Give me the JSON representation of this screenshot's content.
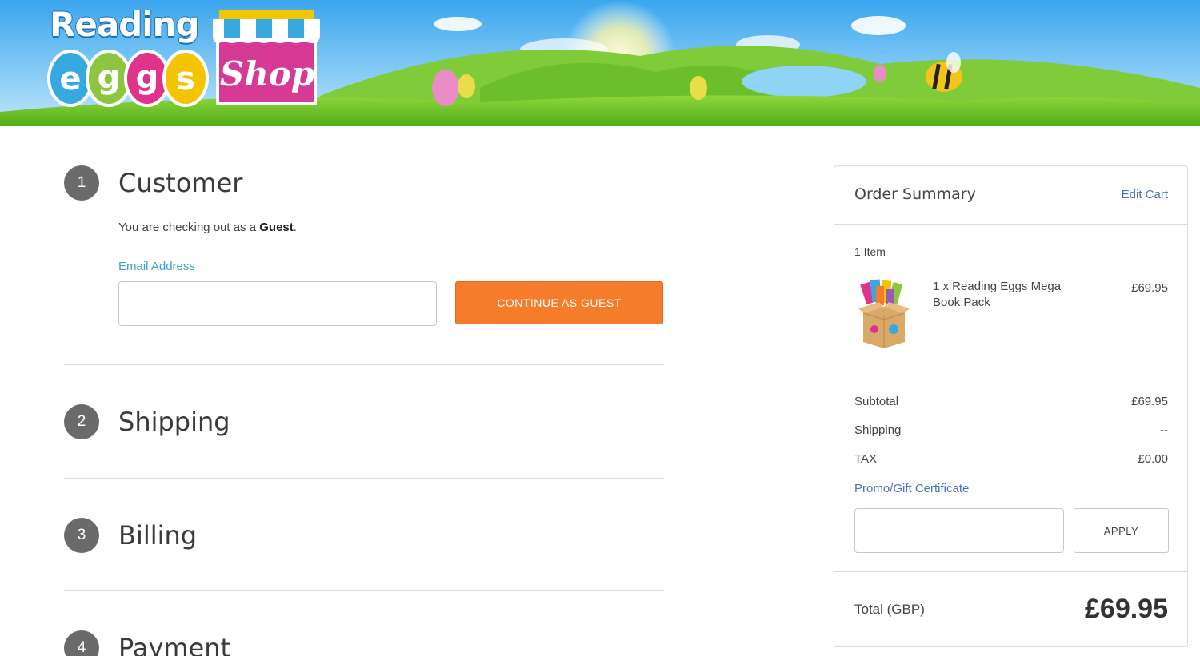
{
  "header": {
    "logo_word": "Reading",
    "logo_letters": [
      "e",
      "g",
      "g",
      "s"
    ],
    "shop_word": "Shop"
  },
  "steps": [
    {
      "number": "1",
      "title": "Customer"
    },
    {
      "number": "2",
      "title": "Shipping"
    },
    {
      "number": "3",
      "title": "Billing"
    },
    {
      "number": "4",
      "title": "Payment"
    }
  ],
  "customer": {
    "checkout_prefix": "You are checking out as a ",
    "checkout_role": "Guest",
    "checkout_suffix": ".",
    "email_label": "Email Address",
    "email_value": "",
    "continue_label": "CONTINUE AS GUEST"
  },
  "summary": {
    "title": "Order Summary",
    "edit_cart": "Edit Cart",
    "item_count": "1 Item",
    "item": {
      "name": "1 x Reading Eggs Mega Book Pack",
      "price": "£69.95"
    },
    "rows": [
      {
        "label": "Subtotal",
        "value": "£69.95"
      },
      {
        "label": "Shipping",
        "value": "--"
      },
      {
        "label": "TAX",
        "value": "£0.00"
      }
    ],
    "promo_label": "Promo/Gift Certificate",
    "promo_value": "",
    "apply_label": "APPLY",
    "total_label": "Total (GBP)",
    "total_value": "£69.95"
  },
  "colors": {
    "accent_orange": "#f47c2a",
    "link_blue": "#4a6fc4",
    "label_blue": "#3aa0d0",
    "step_badge": "#6a6a6a"
  }
}
